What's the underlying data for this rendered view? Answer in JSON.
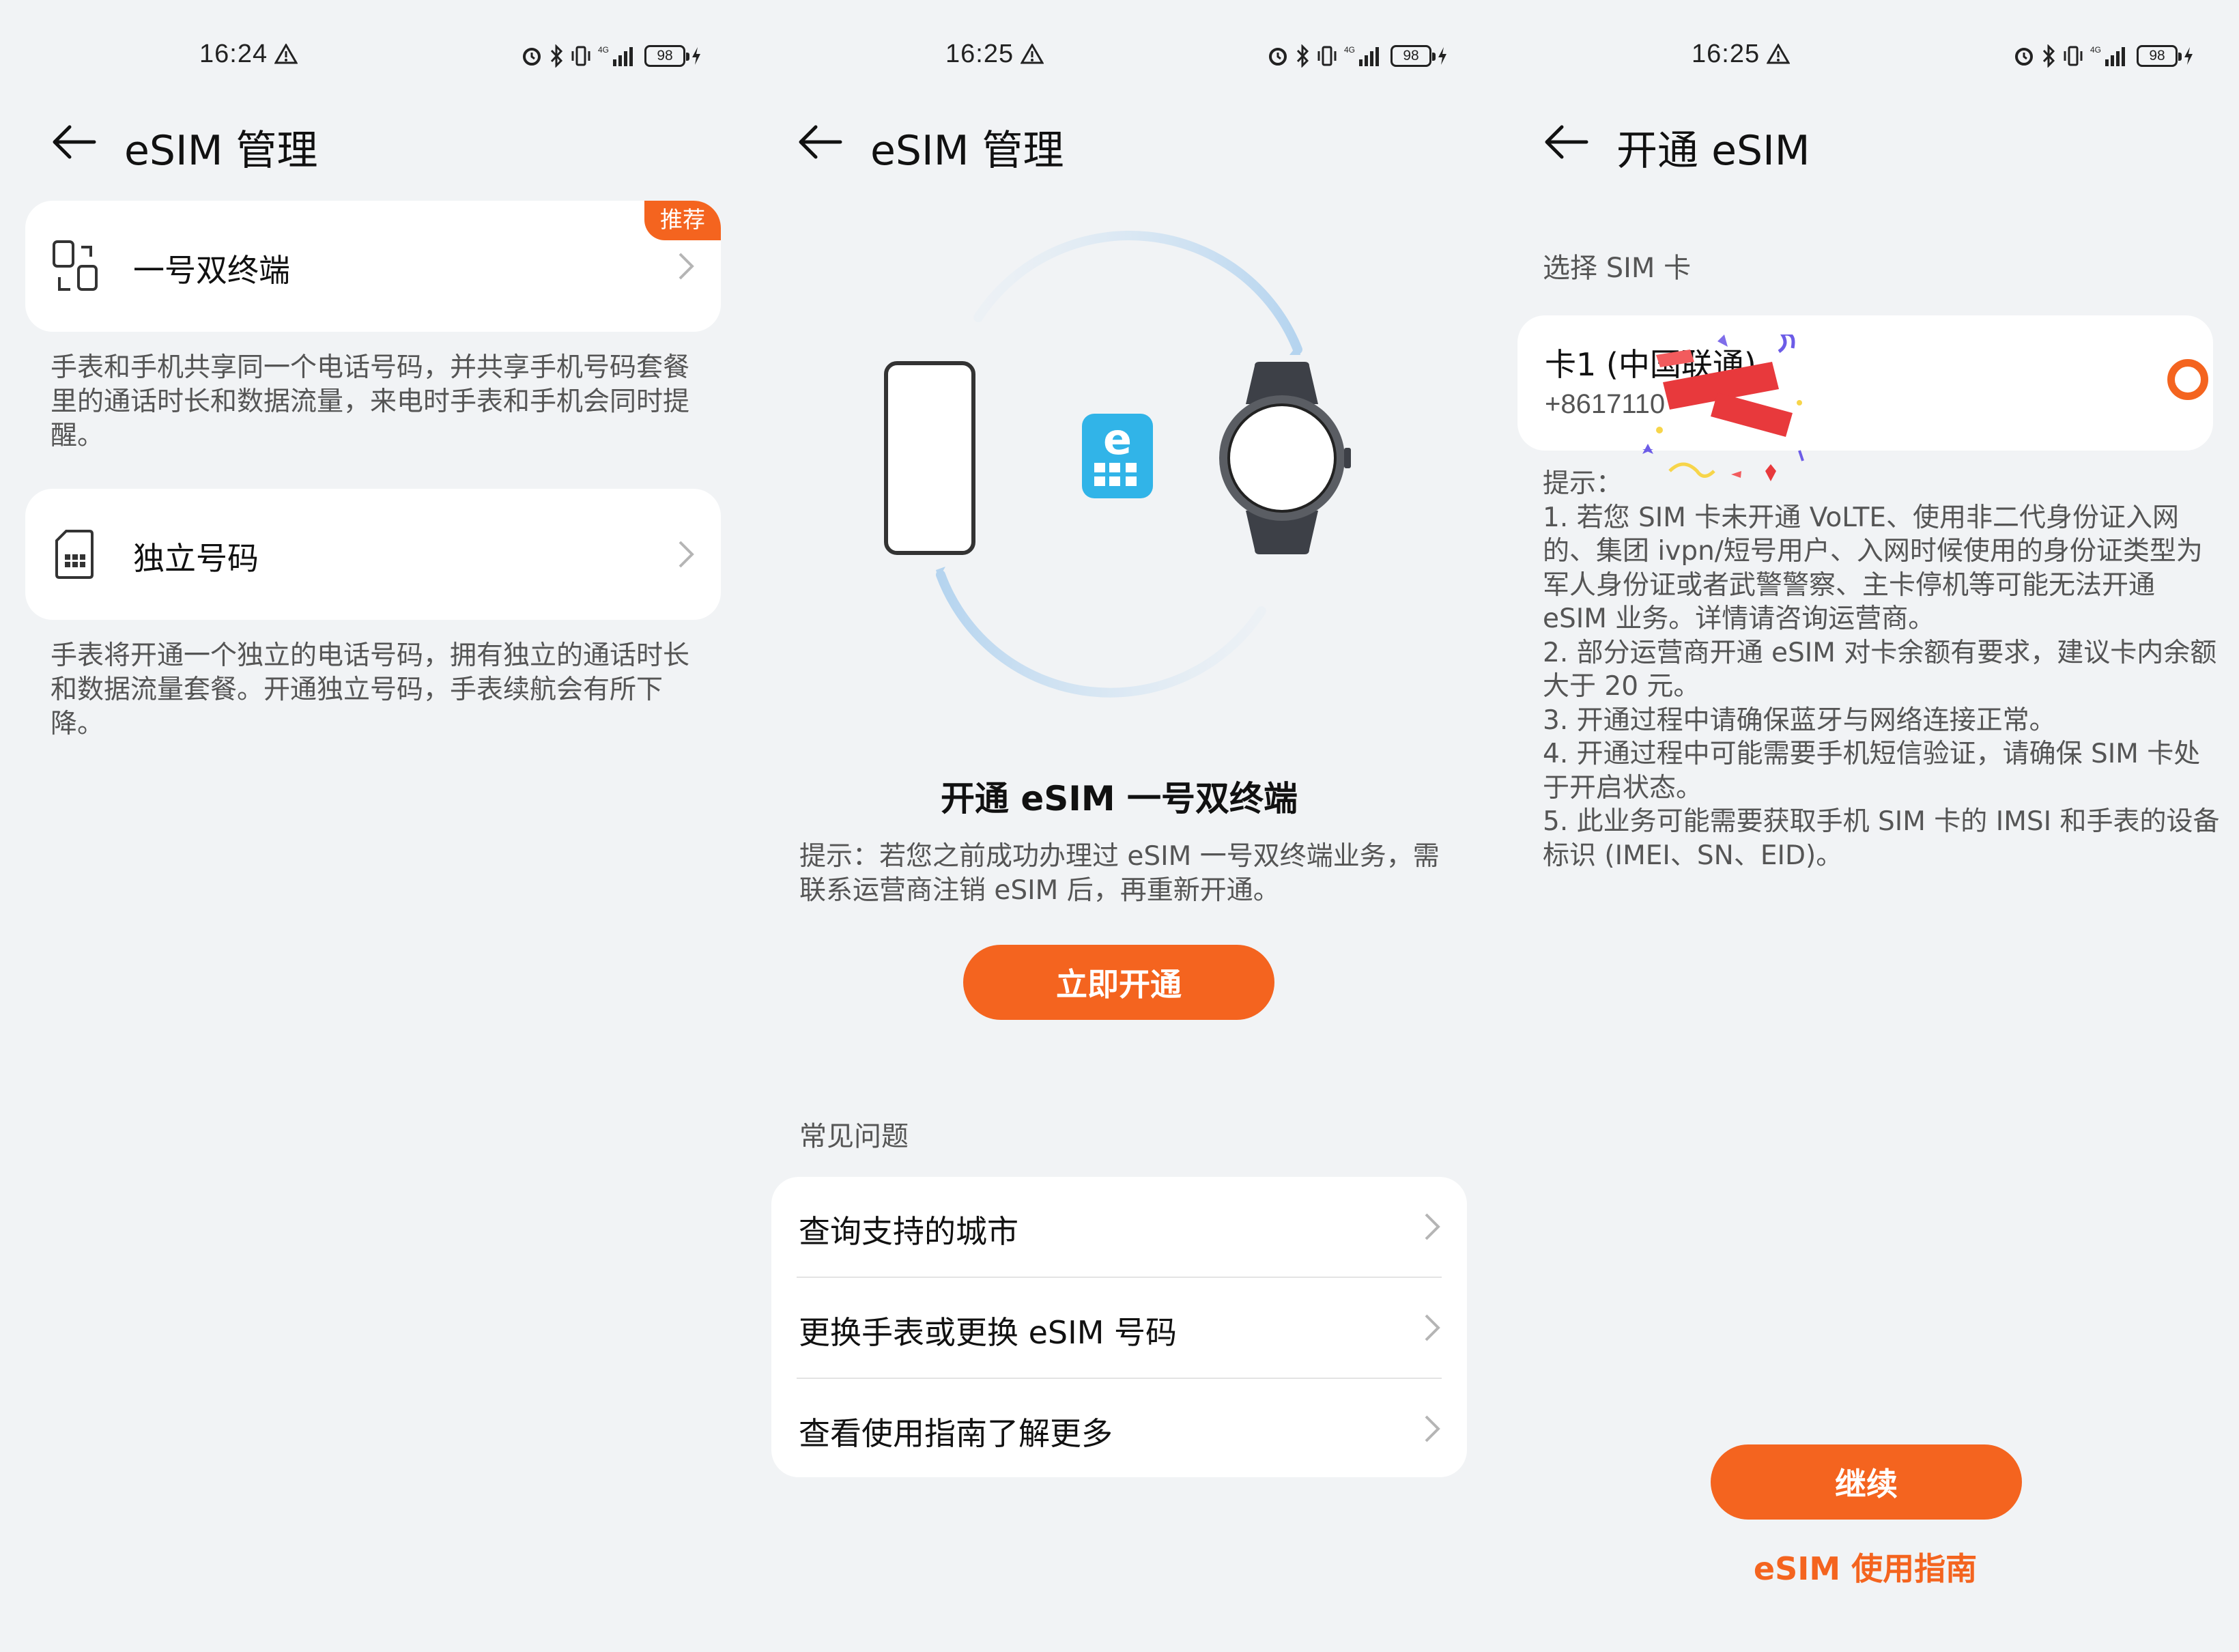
{
  "panels": [
    {
      "status": {
        "time": "16:24",
        "battery": "98"
      },
      "header": {
        "title": "eSIM 管理"
      },
      "cards": [
        {
          "label": "一号双终端",
          "badge": "推荐",
          "icon": "devices-icon",
          "desc": "手表和手机共享同一个电话号码，并共享手机号码套餐里的通话时长和数据流量，来电时手表和手机会同时提醒。"
        },
        {
          "label": "独立号码",
          "icon": "sim-icon",
          "desc": "手表将开通一个独立的电话号码，拥有独立的通话时长和数据流量套餐。开通独立号码，手表续航会有所下降。"
        }
      ]
    },
    {
      "status": {
        "time": "16:25",
        "battery": "98"
      },
      "header": {
        "title": "eSIM 管理"
      },
      "heading": "开通 eSIM 一号双终端",
      "tip": "提示：若您之前成功办理过 eSIM 一号双终端业务，需联系运营商注销 eSIM 后，再重新开通。",
      "activate_button": "立即开通",
      "faq_title": "常见问题",
      "faq": [
        "查询支持的城市",
        "更换手表或更换 eSIM 号码",
        "查看使用指南了解更多"
      ]
    },
    {
      "status": {
        "time": "16:25",
        "battery": "98"
      },
      "header": {
        "title": "开通 eSIM"
      },
      "section": "选择 SIM 卡",
      "sim": {
        "name": "卡1 (中国联通)",
        "number": "+8617110"
      },
      "notes_title": "提示：",
      "notes": [
        "1. 若您 SIM 卡未开通 VoLTE、使用非二代身份证入网的、集团 ivpn/短号用户、入网时候使用的身份证类型为军人身份证或者武警警察、主卡停机等可能无法开通 eSIM 业务。详情请咨询运营商。",
        "2. 部分运营商开通 eSIM 对卡余额有要求，建议卡内余额大于 20 元。",
        "3. 开通过程中请确保蓝牙与网络连接正常。",
        "4. 开通过程中可能需要手机短信验证，请确保 SIM 卡处于开启状态。",
        "5. 此业务可能需要获取手机 SIM 卡的 IMSI 和手表的设备标识 (IMEI、SN、EID)。"
      ],
      "continue_button": "继续",
      "guide_link": "eSIM 使用指南"
    }
  ],
  "colors": {
    "accent": "#f4641f",
    "background": "#f1f3f5",
    "card": "#ffffff",
    "esim_icon": "#31b4e8"
  }
}
